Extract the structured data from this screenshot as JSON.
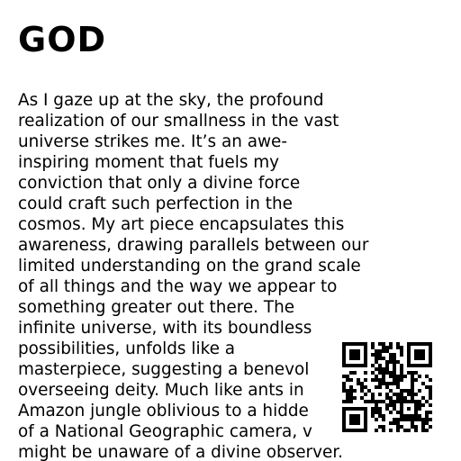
{
  "document": {
    "title": "GOD",
    "body_lines": [
      "As I gaze up at the sky, the profound",
      "realization of our smallness in the vast",
      "universe strikes me. It’s an awe-",
      "inspiring moment that fuels my",
      "conviction that only a divine force",
      "could craft such perfection in the",
      "cosmos. My art piece encapsulates this",
      "awareness, drawing parallels between our",
      "limited understanding on the grand scale",
      "of all things and the way we appear to",
      "something greater out there. The",
      "infinite universe, with its boundless",
      "possibilities, unfolds like a",
      "masterpiece, suggesting a benevol",
      "overseeing deity. Much like ants in",
      "Amazon jungle oblivious to a hidde",
      "of a National Geographic camera, v",
      "might be unaware of a divine observer."
    ]
  },
  "qr_code": {
    "icon": "qr-code-icon",
    "color": "#000000"
  }
}
